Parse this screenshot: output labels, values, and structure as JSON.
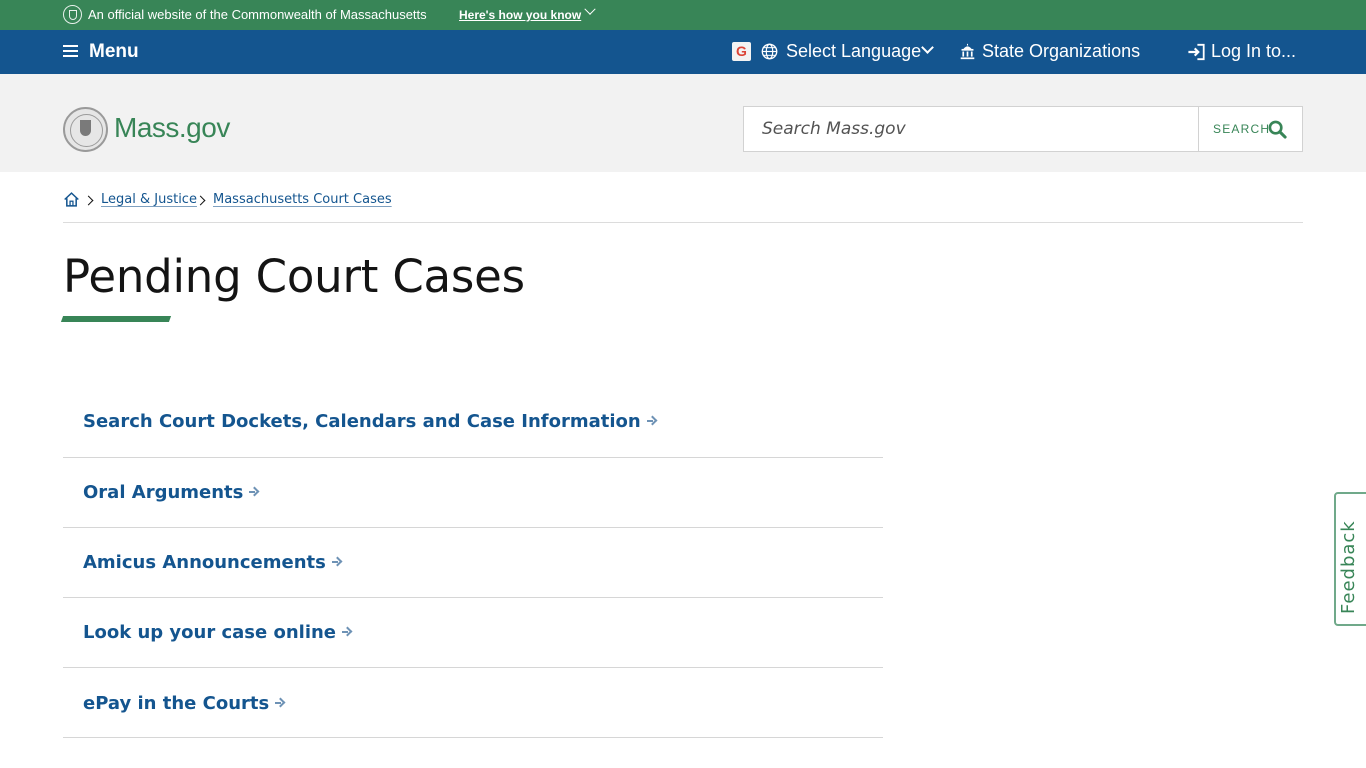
{
  "official_banner": {
    "text": "An official website of the Commonwealth of Massachusetts",
    "how_link": "Here's how you know"
  },
  "utility_nav": {
    "menu_label": "Menu",
    "google_translate_letter": "G",
    "language_label": "Select Language",
    "organizations_label": "State Organizations",
    "login_label": "Log In to..."
  },
  "header": {
    "logo_text": "Mass.gov",
    "search_placeholder": "Search Mass.gov",
    "search_button_label": "SEARCH"
  },
  "breadcrumb": {
    "items": [
      {
        "label": "Legal & Justice"
      },
      {
        "label": "Massachusetts Court Cases"
      }
    ]
  },
  "page": {
    "title": "Pending Court Cases"
  },
  "links": [
    {
      "label": "Search Court Dockets, Calendars and Case Information"
    },
    {
      "label": "Oral Arguments"
    },
    {
      "label": "Amicus Announcements"
    },
    {
      "label": "Look up your case online"
    },
    {
      "label": "ePay in the Courts"
    }
  ],
  "feedback": {
    "label": "Feedback"
  },
  "colors": {
    "green": "#388557",
    "blue": "#14558f",
    "header_bg": "#f2f2f2"
  },
  "icons": [
    "shield-seal-icon",
    "chevron-down-icon",
    "hamburger-menu-icon",
    "google-icon",
    "globe-icon",
    "capitol-building-icon",
    "login-icon",
    "search-icon",
    "home-icon",
    "chevron-right-icon",
    "arrow-right-icon"
  ]
}
